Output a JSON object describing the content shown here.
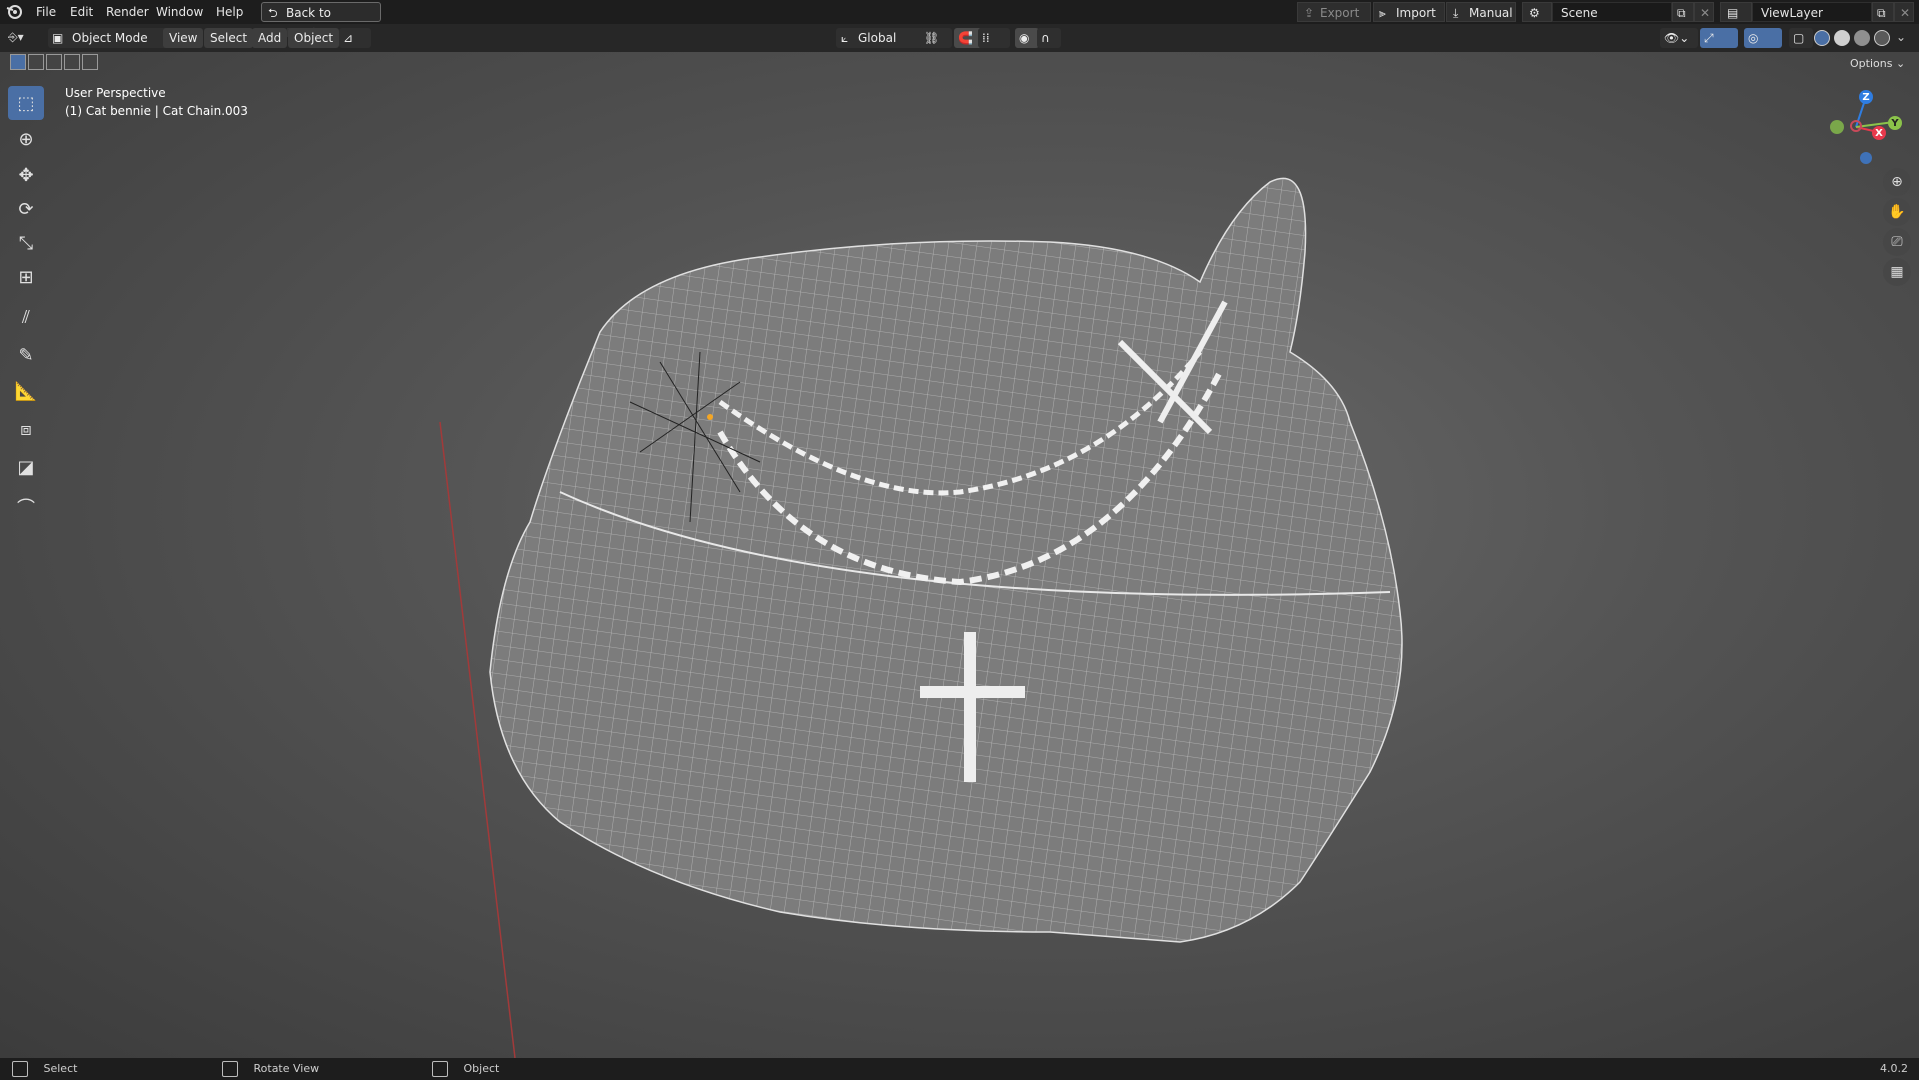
{
  "topbar": {
    "menus": [
      "File",
      "Edit",
      "Render",
      "Window",
      "Help"
    ],
    "back_button": "Back to Previous",
    "export_label": "Export",
    "import_label": "Import",
    "manual_label": "Manual",
    "scene_name": "Scene",
    "view_layer": "ViewLayer"
  },
  "viewport_header": {
    "mode": "Object Mode",
    "menus": [
      "View",
      "Select",
      "Add",
      "Object"
    ],
    "transform_orientation": "Global",
    "options_label": "Options"
  },
  "overlay": {
    "view_name": "User Perspective",
    "object_info": "(1) Cat bennie | Cat Chain.003"
  },
  "gizmo": {
    "axes": [
      "Z",
      "X",
      "Y"
    ],
    "colors": {
      "x": "#e8394c",
      "y": "#8bc34a",
      "z": "#2f7de1"
    }
  },
  "toolbar": {
    "tools": [
      "select-box-icon",
      "cursor-icon",
      "move-icon",
      "rotate-icon",
      "scale-icon",
      "transform-icon",
      "annotate-icon",
      "annotate-line-icon",
      "measure-icon",
      "add-cube-icon",
      "shear-icon",
      "bend-icon"
    ]
  },
  "statusbar": {
    "select": "Select",
    "rotate_view": "Rotate View",
    "object": "Object",
    "version": "4.0.2"
  },
  "colors": {
    "accent": "#4a6fa5",
    "topbar_bg": "#1d1d1d"
  }
}
